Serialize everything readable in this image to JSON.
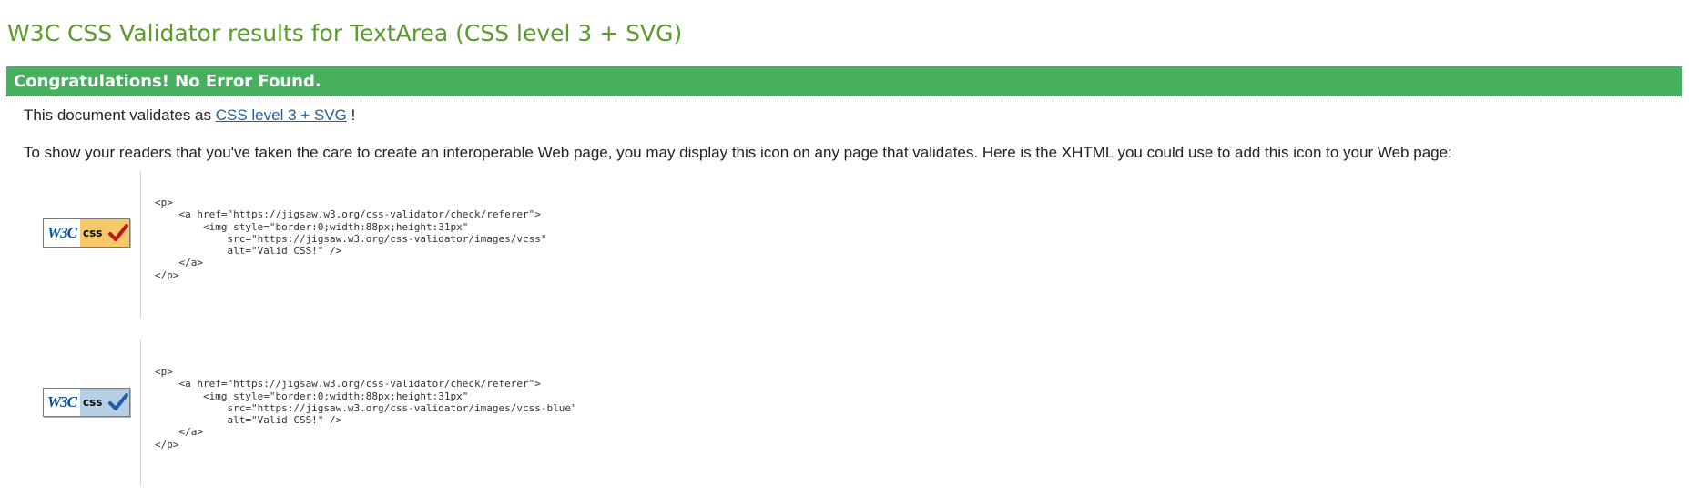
{
  "header": {
    "title": "W3C CSS Validator results for TextArea (CSS level 3 + SVG)"
  },
  "banner": {
    "text": "Congratulations! No Error Found.",
    "color": "#46b05e"
  },
  "validation": {
    "prefix": "This document validates as ",
    "link_text": "CSS level 3 + SVG",
    "suffix": " !"
  },
  "icon_info": {
    "text": "To show your readers that you've taken the care to create an interoperable Web page, you may display this icon on any page that validates. Here is the XHTML you could use to add this icon to your Web page:"
  },
  "badges": [
    {
      "w3c_text": "W3C",
      "css_text": "css",
      "variant": "yellow",
      "check_color": "#c0141c",
      "icon": "valid-css-badge-icon",
      "code": "<p>\n    <a href=\"https://jigsaw.w3.org/css-validator/check/referer\">\n        <img style=\"border:0;width:88px;height:31px\"\n            src=\"https://jigsaw.w3.org/css-validator/images/vcss\"\n            alt=\"Valid CSS!\" />\n    </a>\n</p>"
    },
    {
      "w3c_text": "W3C",
      "css_text": "css",
      "variant": "blue",
      "check_color": "#1f5fa8",
      "icon": "valid-css-blue-badge-icon",
      "code": "<p>\n    <a href=\"https://jigsaw.w3.org/css-validator/check/referer\">\n        <img style=\"border:0;width:88px;height:31px\"\n            src=\"https://jigsaw.w3.org/css-validator/images/vcss-blue\"\n            alt=\"Valid CSS!\" />\n    </a>\n</p>"
    }
  ]
}
